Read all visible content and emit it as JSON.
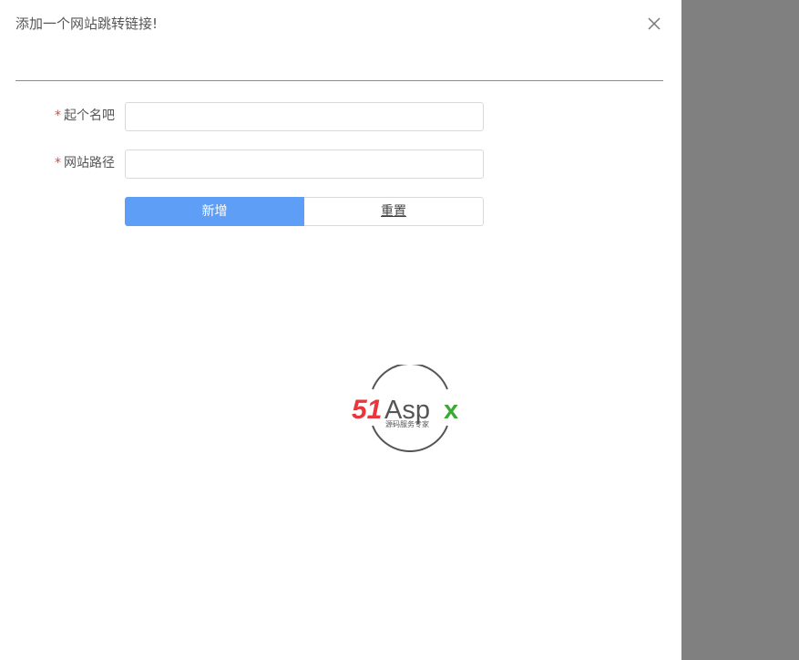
{
  "dialog": {
    "title": "添加一个网站跳转链接!",
    "close_icon": "close-icon"
  },
  "form": {
    "required_mark": "*",
    "name_field": {
      "label": "起个名吧",
      "value": "",
      "placeholder": ""
    },
    "path_field": {
      "label": "网站路径",
      "value": "",
      "placeholder": ""
    },
    "submit_label": "新增",
    "reset_label": "重置"
  },
  "watermark": {
    "brand_part1": "51",
    "brand_part2": "Asp",
    "brand_part3": "x",
    "tagline": "源码服务专家"
  },
  "colors": {
    "primary": "#5f9ef7",
    "required": "#e0473f",
    "overlay": "#808080",
    "logo_red": "#e8363c",
    "logo_green": "#3aaa35",
    "logo_gray": "#555555"
  }
}
